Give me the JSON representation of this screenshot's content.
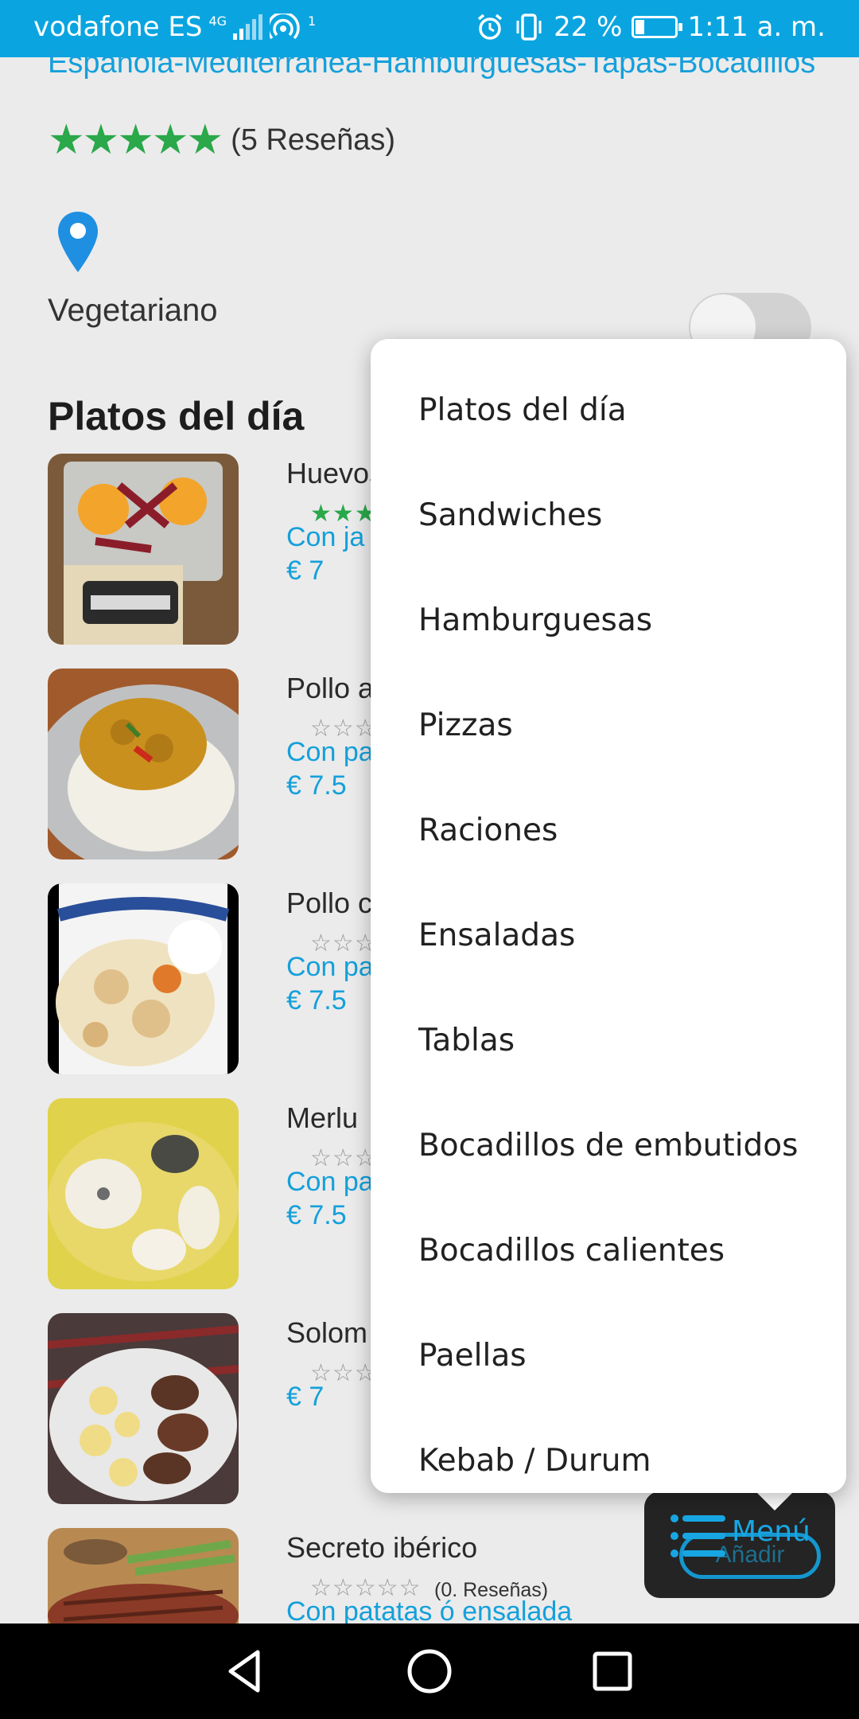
{
  "status_bar": {
    "carrier": "vodafone ES",
    "network": "4G",
    "hotspot_count": "1",
    "battery": "22 %",
    "time": "1:11 a. m."
  },
  "restaurant": {
    "cuisine": "Española-Mediterranea-Hamburguesas-Tapas-Bocadillos",
    "rating_stars": "★★★★★",
    "reviews": "(5 Reseñas)",
    "vegetarian_label": "Vegetariano"
  },
  "section_title": "Platos del día",
  "dishes": [
    {
      "name": "Huevos",
      "stars": "★★★",
      "reviews": "",
      "side": "Con ja",
      "price": "€ 7"
    },
    {
      "name": "Pollo a",
      "stars": "☆☆☆",
      "reviews": "",
      "side": "Con pa",
      "price": "€ 7.5"
    },
    {
      "name": "Pollo c",
      "stars": "☆☆☆",
      "reviews": "",
      "side": "Con pa",
      "price": "€ 7.5"
    },
    {
      "name": "Merlu",
      "stars": "☆☆☆",
      "reviews": "",
      "side": "Con pa",
      "price": "€ 7.5"
    },
    {
      "name": "Solom",
      "stars": "☆☆☆",
      "reviews": "",
      "side": "",
      "price": "€ 7"
    },
    {
      "name": "Secreto ibérico",
      "stars": "☆☆☆☆☆",
      "reviews": "(0. Reseñas)",
      "side": "Con patatas ó ensalada",
      "price": ""
    }
  ],
  "menu_popup": {
    "items": [
      "Platos del día",
      "Sandwiches",
      "Hamburguesas",
      "Pizzas",
      "Raciones",
      "Ensaladas",
      "Tablas",
      "Bocadillos de embutidos",
      "Bocadillos calientes",
      "Paellas",
      "Kebab / Durum"
    ]
  },
  "fab": {
    "label": "Menú",
    "add_label": "Añadir"
  },
  "colors": {
    "accent": "#14a0db",
    "status_bar": "#0aa5e0",
    "star_green": "#2aa84a"
  },
  "icons": [
    "map-pin-icon",
    "hamburger-menu-icon",
    "nav-back-icon",
    "nav-home-icon",
    "nav-recents-icon"
  ]
}
